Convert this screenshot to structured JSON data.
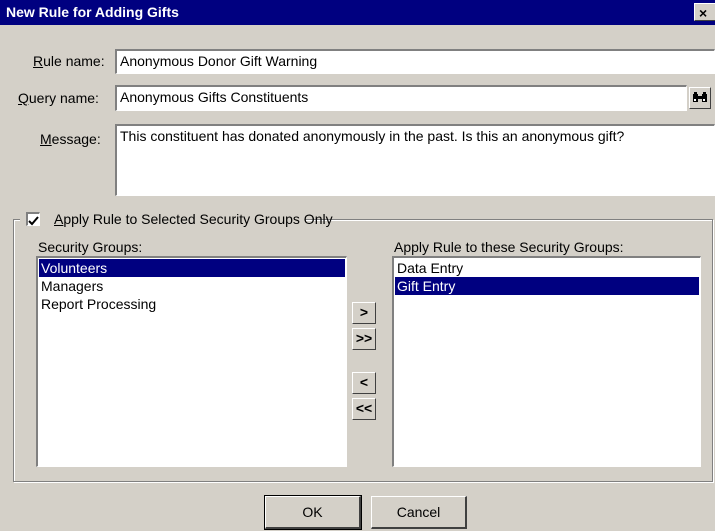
{
  "window": {
    "title": "New Rule for Adding Gifts",
    "close_glyph": "×"
  },
  "form": {
    "rule_name_label": "Rule name:",
    "rule_name_value": "Anonymous Donor Gift Warning",
    "query_name_label": "Query name:",
    "query_name_value": "Anonymous Gifts Constituents",
    "lookup_icon": "binoculars-icon",
    "message_label": "Message:",
    "message_value": "This constituent has donated anonymously in the past.  Is this an anonymous gift?"
  },
  "security": {
    "apply_checkbox_label": "Apply Rule to Selected Security Groups Only",
    "apply_checked": true,
    "groups_label": "Security Groups:",
    "groups": [
      {
        "label": "Volunteers",
        "selected": true
      },
      {
        "label": "Managers",
        "selected": false
      },
      {
        "label": "Report Processing",
        "selected": false
      }
    ],
    "applied_label": "Apply Rule to these Security Groups:",
    "applied_groups": [
      {
        "label": "Data Entry",
        "selected": false
      },
      {
        "label": "Gift Entry",
        "selected": true
      }
    ],
    "move_right": ">",
    "move_all_right": ">>",
    "move_left": "<",
    "move_all_left": "<<"
  },
  "buttons": {
    "ok": "OK",
    "cancel": "Cancel"
  },
  "colors": {
    "title_bar": "#000080",
    "selection": "#000080",
    "face": "#d4d0c8"
  }
}
